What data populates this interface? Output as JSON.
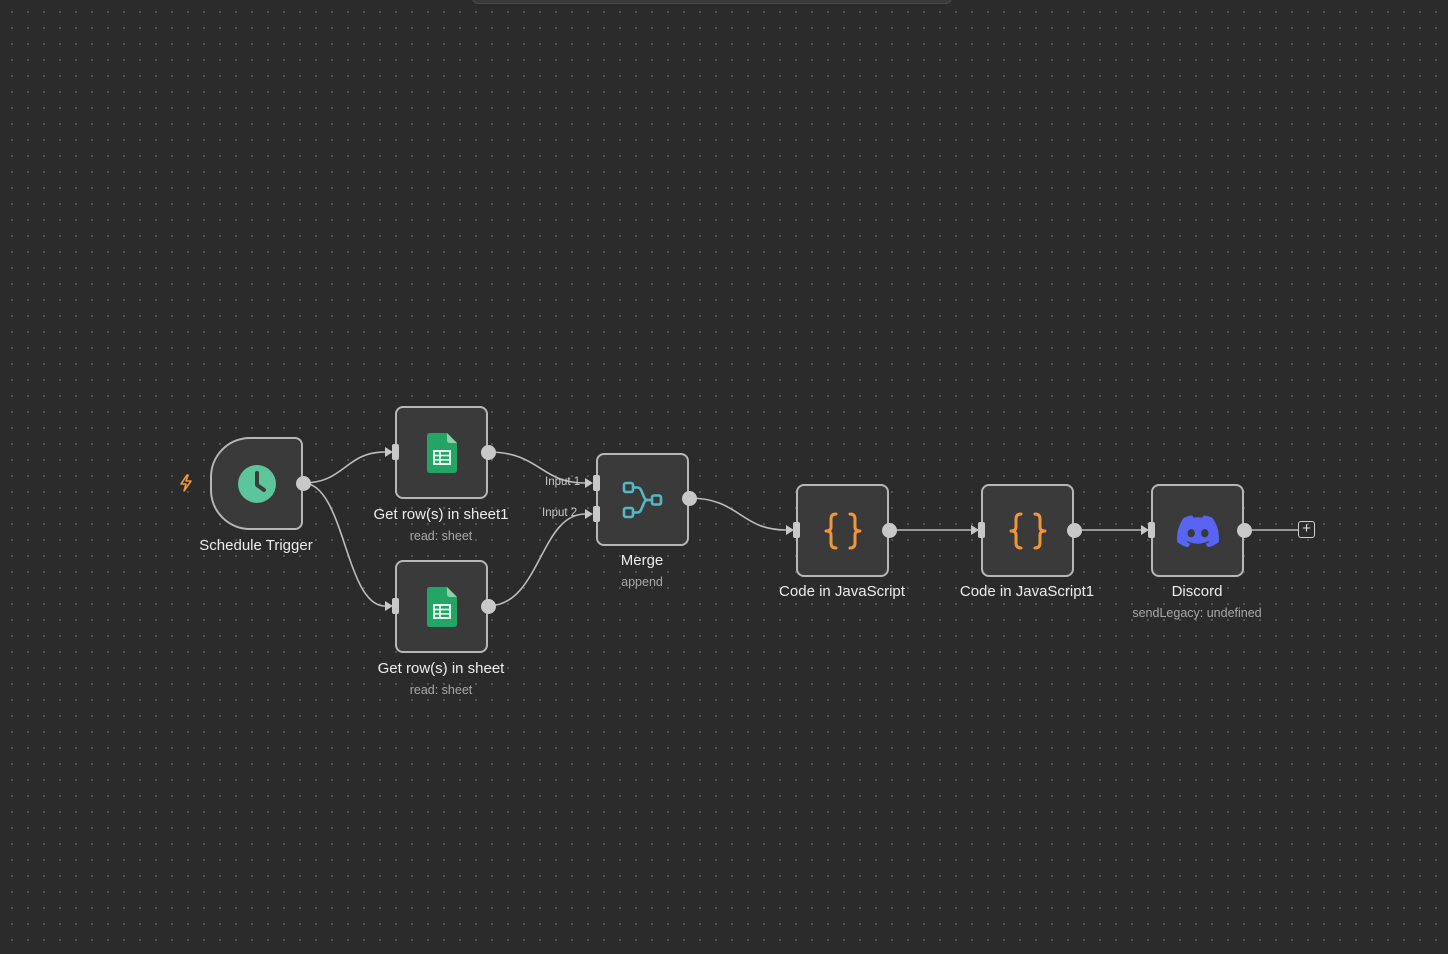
{
  "canvas": {
    "add_button_label": "+"
  },
  "nodes": {
    "schedule_trigger": {
      "title": "Schedule Trigger",
      "icon": "clock-icon",
      "icon_color": "#5dc59b"
    },
    "get_rows_sheet1": {
      "title": "Get row(s) in sheet1",
      "subtitle": "read: sheet",
      "icon": "google-sheets-icon",
      "icon_color": "#23a565"
    },
    "get_rows_sheet": {
      "title": "Get row(s) in sheet",
      "subtitle": "read: sheet",
      "icon": "google-sheets-icon",
      "icon_color": "#23a565"
    },
    "merge": {
      "title": "Merge",
      "subtitle": "append",
      "icon": "merge-icon",
      "icon_color": "#54b8c8",
      "input_1_label": "Input 1",
      "input_2_label": "Input 2"
    },
    "code_js": {
      "title": "Code in JavaScript",
      "icon": "code-braces-icon",
      "icon_color": "#f0963a"
    },
    "code_js1": {
      "title": "Code in JavaScript1",
      "icon": "code-braces-icon",
      "icon_color": "#f0963a"
    },
    "discord": {
      "title": "Discord",
      "subtitle": "sendLegacy: undefined",
      "icon": "discord-icon",
      "icon_color": "#5865f2"
    }
  },
  "colors": {
    "canvas_bg": "#2b2b2b",
    "node_bg": "#3a3a3a",
    "node_border": "#b7b7b7",
    "connection": "#c8c8c8",
    "trigger_bolt": "#f0963a"
  }
}
